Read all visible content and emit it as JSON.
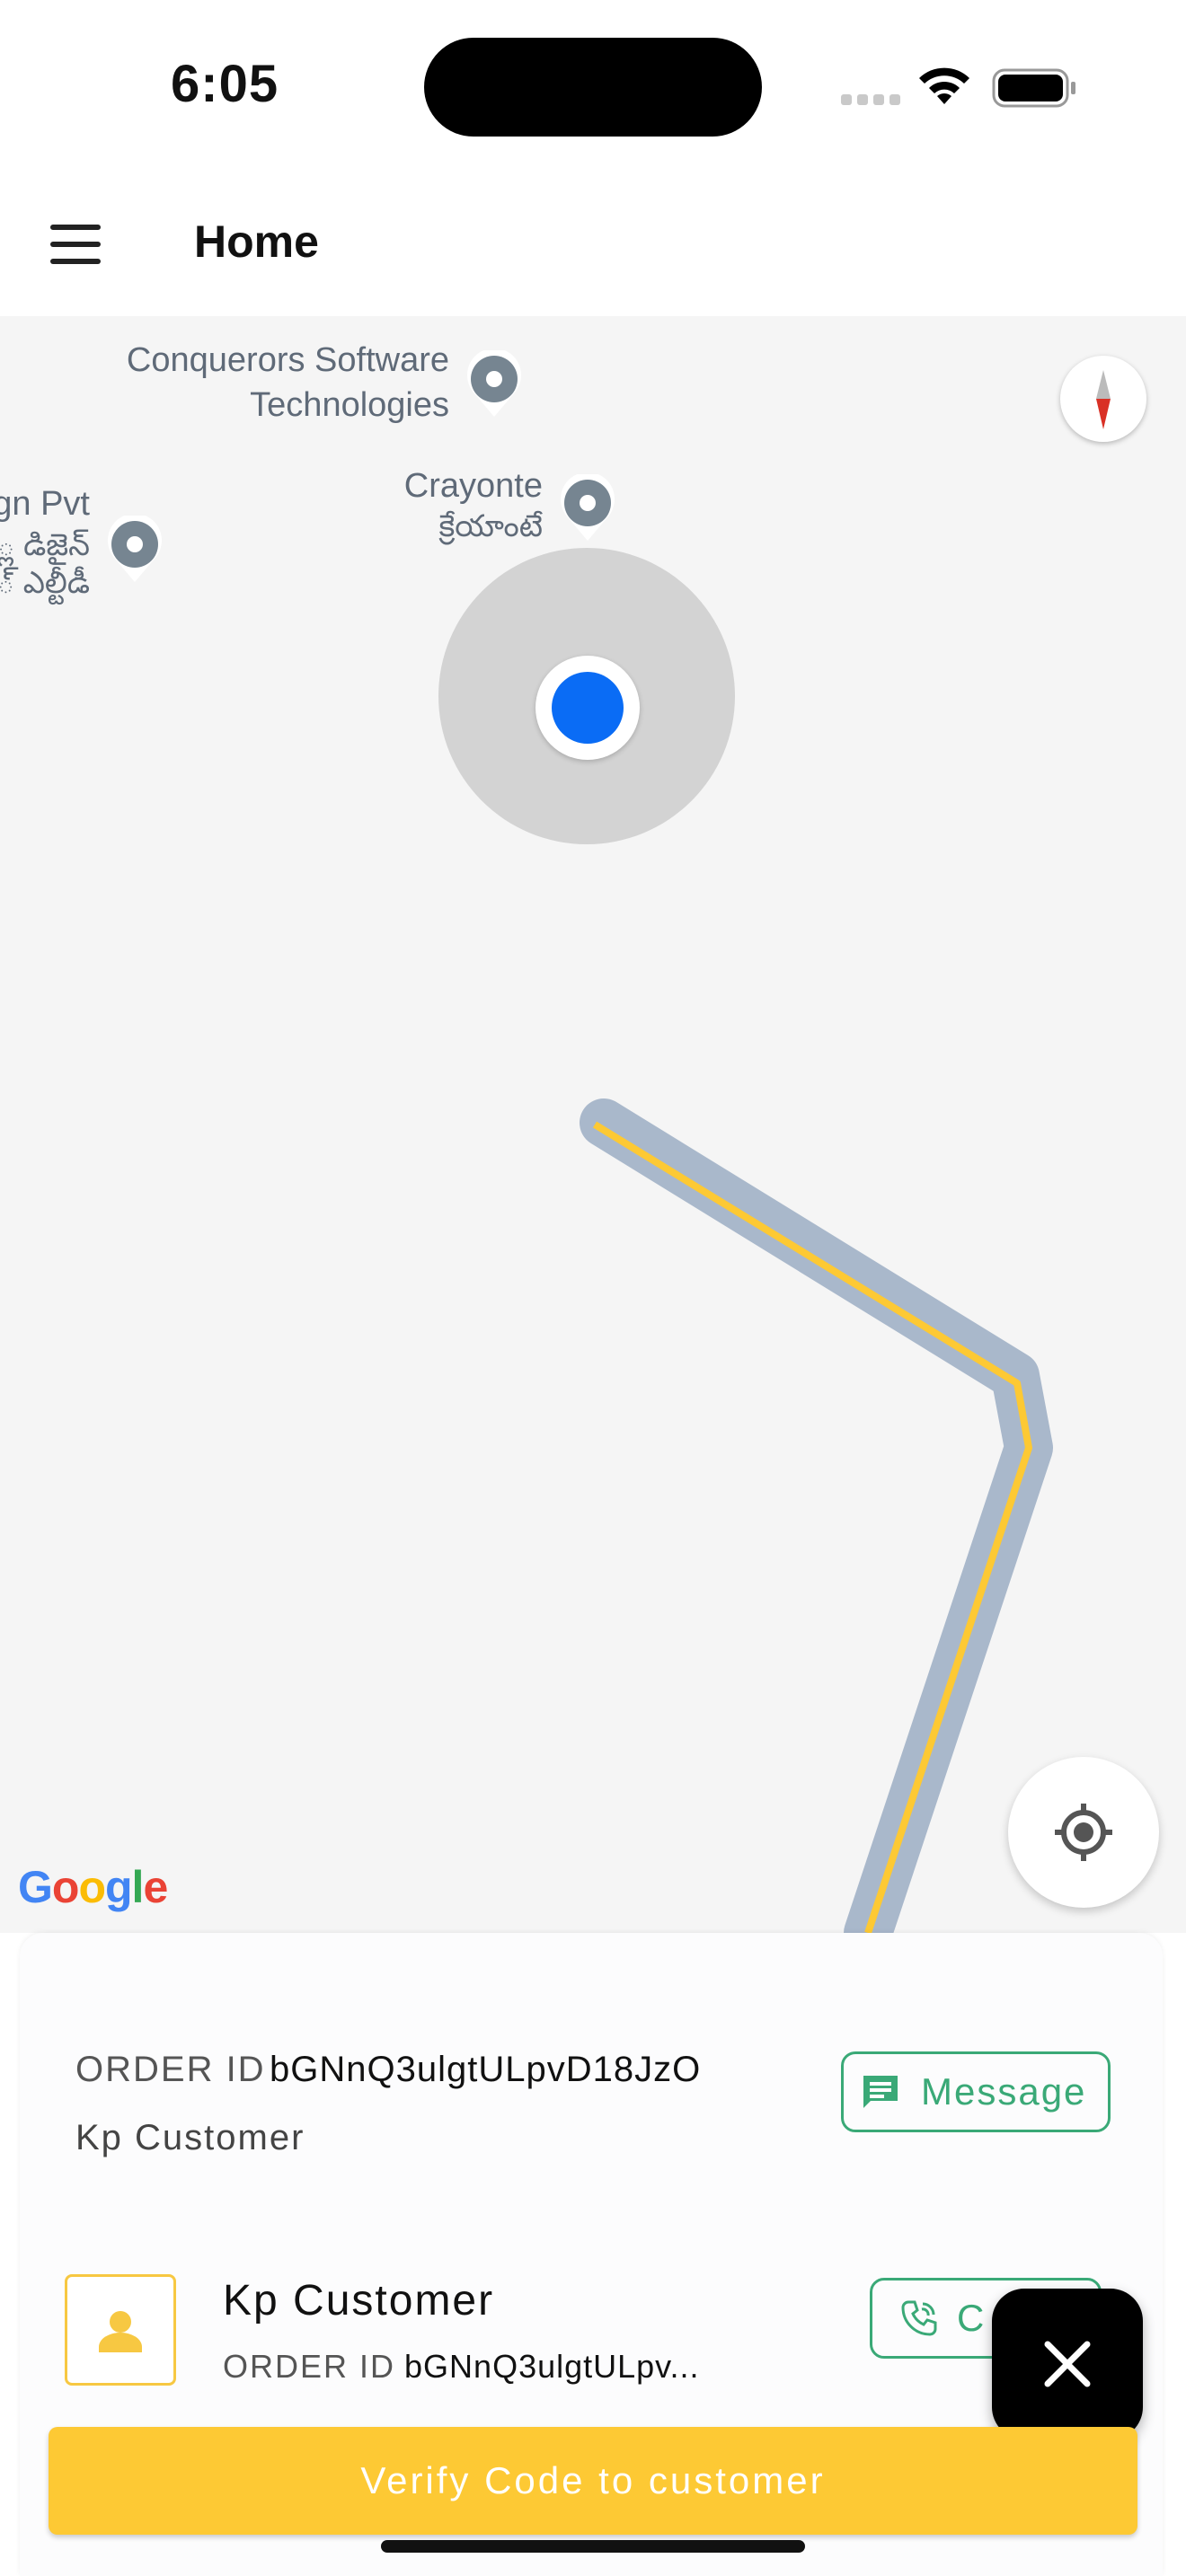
{
  "status_bar": {
    "time": "6:05"
  },
  "app_bar": {
    "title": "Home",
    "menu_icon": "menu-icon"
  },
  "map": {
    "pois": [
      {
        "name": "Conquerors Software Technologies",
        "line1": "Conquerors Software",
        "line2": "Technologies"
      },
      {
        "name": "Crayonte",
        "line1": "Crayonte",
        "line2": "క్రేయాంటే"
      },
      {
        "name": "design pvt ltd (partially visible)",
        "line1": "gn Pvt",
        "line2": "్ల డిజైన్",
        "line3": "్ ఎల్టీడీ"
      }
    ],
    "route_colors": {
      "outline": "#a9b8cb",
      "line": "#fdc934"
    },
    "user_location_color": "#0a6cf5",
    "google_logo": {
      "letters": [
        "G",
        "o",
        "o",
        "g",
        "l",
        "e"
      ],
      "colors": [
        "#4285F4",
        "#EA4335",
        "#FBBC05",
        "#4285F4",
        "#34A853",
        "#EA4335"
      ]
    },
    "compass_icon": "compass-icon",
    "my_location_icon": "my-location-icon"
  },
  "sheet": {
    "order": {
      "label": "ORDER ID",
      "id": "bGNnQ3ulgtULpvD18JzO",
      "customer": "Kp Customer"
    },
    "message_button": {
      "label": "Message",
      "icon": "message-icon"
    },
    "customer_card": {
      "name": "Kp Customer",
      "order_label": "ORDER ID",
      "order_id_truncated": "bGNnQ3ulgtULpv...",
      "avatar_icon": "person-icon"
    },
    "call_button": {
      "label": "Call",
      "visible_label": "C",
      "icon": "phone-icon"
    },
    "close_fab_icon": "close-icon",
    "verify_button": {
      "label": "Verify Code to customer"
    }
  },
  "colors": {
    "accent_green": "#3aa977",
    "accent_yellow": "#fdc934"
  }
}
